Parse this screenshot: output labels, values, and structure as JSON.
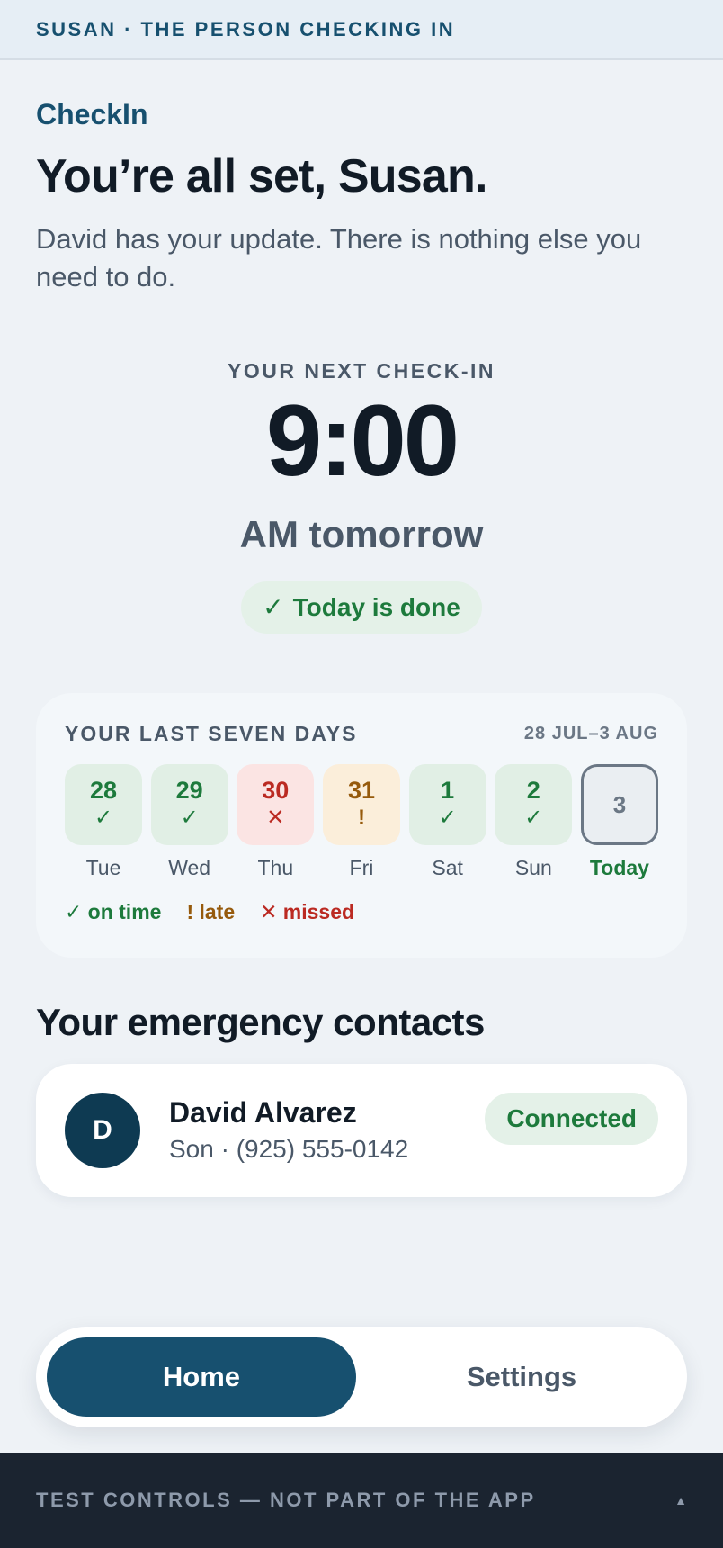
{
  "banner": {
    "text": "SUSAN · THE PERSON CHECKING IN"
  },
  "brand": "CheckIn",
  "headline": "You’re all set, Susan.",
  "subtext": "David has your update. There is nothing else you need to do.",
  "next_checkin": {
    "label": "YOUR NEXT CHECK-IN",
    "time": "9:00",
    "day": "AM tomorrow",
    "status_check": "✓",
    "status": "Today is done"
  },
  "week": {
    "title": "YOUR LAST SEVEN DAYS",
    "range": "28 JUL–3 AUG",
    "days": [
      {
        "num": "28",
        "mark": "✓",
        "label": "Tue",
        "status": "on time"
      },
      {
        "num": "29",
        "mark": "✓",
        "label": "Wed",
        "status": "on time"
      },
      {
        "num": "30",
        "mark": "✕",
        "label": "Thu",
        "status": "missed"
      },
      {
        "num": "31",
        "mark": "!",
        "label": "Fri",
        "status": "late"
      },
      {
        "num": "1",
        "mark": "✓",
        "label": "Sat",
        "status": "on time"
      },
      {
        "num": "2",
        "mark": "✓",
        "label": "Sun",
        "status": "on time"
      },
      {
        "num": "3",
        "mark": "",
        "label": "Today",
        "status": "pending"
      }
    ],
    "legend": {
      "on_time": "✓ on time",
      "late": "! late",
      "missed": "✕ missed"
    }
  },
  "contacts": {
    "title": "Your emergency contacts",
    "items": [
      {
        "initial": "D",
        "name": "David Alvarez",
        "detail": "Son · (925) 555-0142",
        "status": "Connected"
      }
    ]
  },
  "tabs": [
    {
      "label": "Home",
      "active": true
    },
    {
      "label": "Settings",
      "active": false
    }
  ],
  "test_controls": {
    "label": "TEST CONTROLS — NOT PART OF THE APP",
    "toggle_icon": "▲"
  },
  "colors": {
    "brand": "#17506f",
    "on_time": "#1d7a3c",
    "late": "#965a0c",
    "missed": "#bb2a22"
  }
}
